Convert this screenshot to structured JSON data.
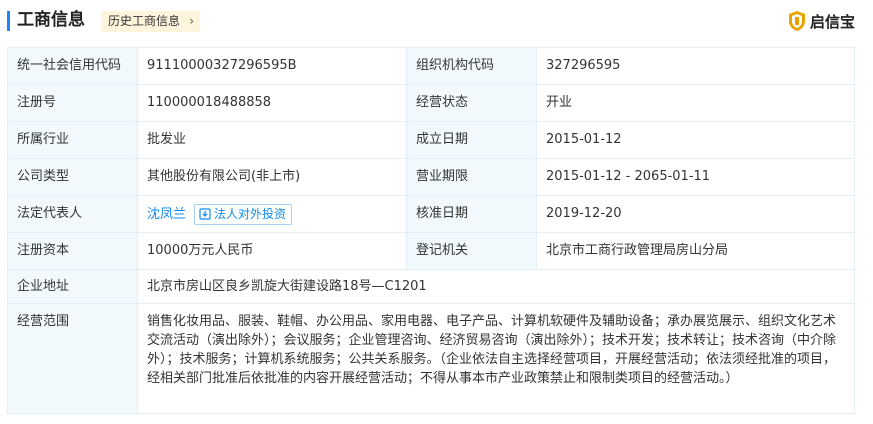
{
  "header": {
    "title": "工商信息",
    "history_tag": "历史工商信息",
    "brand": "启信宝"
  },
  "colors": {
    "accent": "#1a85ff",
    "link": "#128bed",
    "label_bg": "#f2f9fc",
    "tag_bg": "#fff4dc",
    "brand": "#e8a300"
  },
  "fields": {
    "credit_code": {
      "label": "统一社会信用代码",
      "value": "91110000327296595B"
    },
    "org_code": {
      "label": "组织机构代码",
      "value": "327296595"
    },
    "reg_no": {
      "label": "注册号",
      "value": "110000018488858"
    },
    "status": {
      "label": "经营状态",
      "value": "开业"
    },
    "industry": {
      "label": "所属行业",
      "value": "批发业"
    },
    "founded": {
      "label": "成立日期",
      "value": "2015-01-12"
    },
    "company_type": {
      "label": "公司类型",
      "value": "其他股份有限公司(非上市)"
    },
    "term": {
      "label": "营业期限",
      "value": "2015-01-12 - 2065-01-11"
    },
    "legal_rep": {
      "label": "法定代表人",
      "value": "沈凤兰",
      "invest_button": "法人对外投资"
    },
    "approval_date": {
      "label": "核准日期",
      "value": "2019-12-20"
    },
    "capital": {
      "label": "注册资本",
      "value": "10000万元人民币"
    },
    "authority": {
      "label": "登记机关",
      "value": "北京市工商行政管理局房山分局"
    },
    "address": {
      "label": "企业地址",
      "value": "北京市房山区良乡凯旋大街建设路18号—C1201"
    },
    "scope": {
      "label": "经营范围",
      "value": "销售化妆用品、服装、鞋帽、办公用品、家用电器、电子产品、计算机软硬件及辅助设备；承办展览展示、组织文化艺术交流活动（演出除外）；会议服务；企业管理咨询、经济贸易咨询（演出除外）；技术开发；技术转让；技术咨询（中介除外）；技术服务；计算机系统服务；公共关系服务。（企业依法自主选择经营项目，开展经营活动；依法须经批准的项目，经相关部门批准后依批准的内容开展经营活动；不得从事本市产业政策禁止和限制类项目的经营活动。）"
    }
  }
}
